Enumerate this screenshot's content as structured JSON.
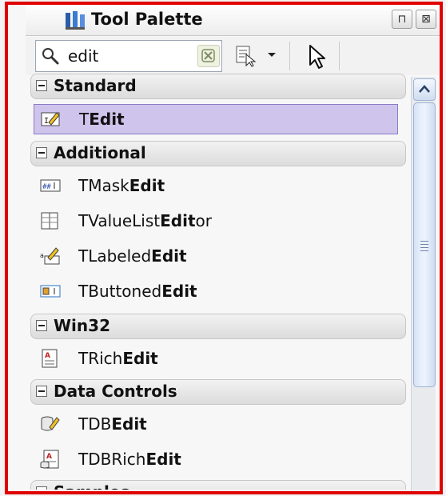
{
  "window": {
    "title": "Tool Palette",
    "pin_glyph": "⊓",
    "close_glyph": "⊠"
  },
  "search": {
    "value": "edit",
    "placeholder": ""
  },
  "categories": [
    {
      "label": "Standard",
      "items": [
        {
          "pre": "T",
          "bold": "Edit",
          "post": "",
          "icon": "tedit-icon",
          "selected": true
        }
      ]
    },
    {
      "label": "Additional",
      "items": [
        {
          "pre": "TMask",
          "bold": "Edit",
          "post": "",
          "icon": "tmaskedit-icon"
        },
        {
          "pre": "TValueList",
          "bold": "Edit",
          "post": "or",
          "icon": "tvaluelisteditor-icon"
        },
        {
          "pre": "TLabeled",
          "bold": "Edit",
          "post": "",
          "icon": "tlabelededit-icon"
        },
        {
          "pre": "TButtoned",
          "bold": "Edit",
          "post": "",
          "icon": "tbuttonededit-icon"
        }
      ]
    },
    {
      "label": "Win32",
      "items": [
        {
          "pre": "TRich",
          "bold": "Edit",
          "post": "",
          "icon": "trichedit-icon"
        }
      ]
    },
    {
      "label": "Data Controls",
      "items": [
        {
          "pre": "TDB",
          "bold": "Edit",
          "post": "",
          "icon": "tdbedit-icon"
        },
        {
          "pre": "TDBRich",
          "bold": "Edit",
          "post": "",
          "icon": "tdbrichedit-icon"
        }
      ]
    },
    {
      "label": "Samples",
      "items": []
    }
  ],
  "colors": {
    "frame": "#e00000",
    "selection": "#cfc4ec",
    "selection_border": "#8a7cc6"
  }
}
